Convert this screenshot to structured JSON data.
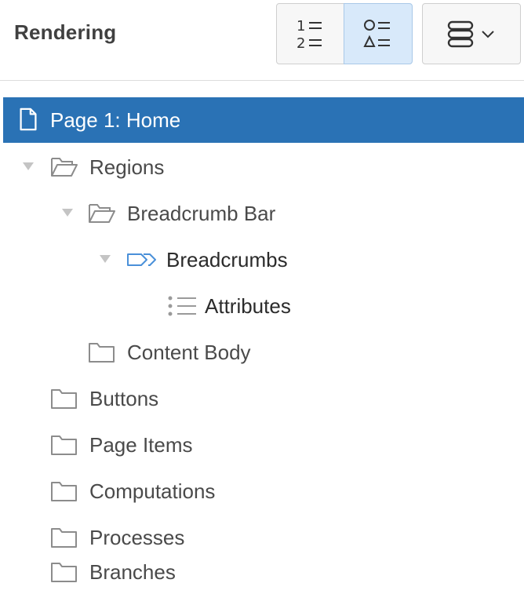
{
  "header": {
    "title": "Rendering"
  },
  "toolbar": {
    "order_view_button": {
      "icon": "numbered-list-icon",
      "glyph_top": "1 ≡",
      "glyph_bottom": "2 ≡"
    },
    "type_view_button": {
      "icon": "component-type-list-icon",
      "active": true
    },
    "menu_button": {
      "icon": "database-stack-icon",
      "caret_icon": "chevron-down-icon"
    }
  },
  "tree": {
    "page": {
      "label": "Page 1: Home",
      "icon": "page-icon",
      "selected": true
    },
    "regions": {
      "label": "Regions",
      "icon": "folder-open-icon",
      "expanded": true
    },
    "breadcrumb_bar": {
      "label": "Breadcrumb Bar",
      "icon": "folder-open-icon",
      "expanded": true
    },
    "breadcrumbs": {
      "label": "Breadcrumbs",
      "icon": "breadcrumb-icon",
      "expanded": true
    },
    "attributes": {
      "label": "Attributes",
      "icon": "attributes-list-icon"
    },
    "content_body": {
      "label": "Content Body",
      "icon": "folder-icon"
    },
    "buttons": {
      "label": "Buttons",
      "icon": "folder-icon"
    },
    "page_items": {
      "label": "Page Items",
      "icon": "folder-icon"
    },
    "computations": {
      "label": "Computations",
      "icon": "folder-icon"
    },
    "processes": {
      "label": "Processes",
      "icon": "folder-icon"
    },
    "branches": {
      "label": "Branches",
      "icon": "folder-icon"
    }
  },
  "colors": {
    "selection": "#2a72b5",
    "active_button": "#d8e9fa",
    "accent_icon": "#4a90d9"
  }
}
